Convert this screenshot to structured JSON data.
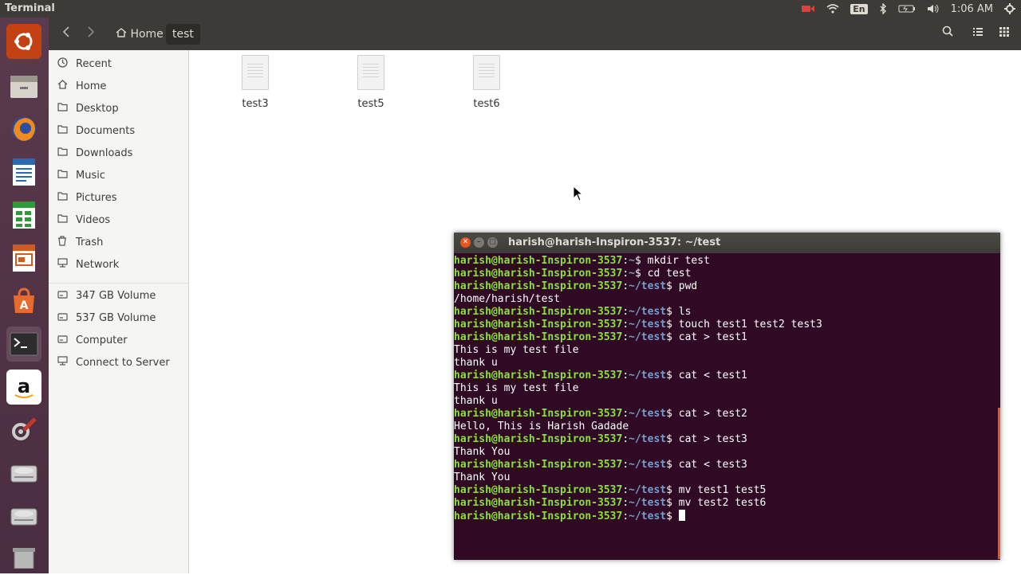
{
  "top_panel": {
    "title": "Terminal",
    "time": "1:06 AM",
    "lang": "En",
    "icons": [
      "camera-icon",
      "wifi-icon",
      "language-icon",
      "bluetooth-icon",
      "battery-icon",
      "volume-icon",
      "gear-icon"
    ]
  },
  "launcher": {
    "items": [
      "ubuntu-icon",
      "files-icon",
      "firefox-icon",
      "writer-icon",
      "calc-icon",
      "impress-icon",
      "software-center-icon",
      "terminal-icon",
      "amazon-icon",
      "settings-icon",
      "disk-icon",
      "disk-icon",
      "trash-icon"
    ]
  },
  "header": {
    "crumbs": [
      "Home",
      "test"
    ],
    "back_icon": "‹",
    "forward_icon": "›"
  },
  "sidebar": {
    "places": [
      "Recent",
      "Home",
      "Desktop",
      "Documents",
      "Downloads",
      "Music",
      "Pictures",
      "Videos",
      "Trash",
      "Network"
    ],
    "devices": [
      "347 GB Volume",
      "537 GB Volume",
      "Computer",
      "Connect to Server"
    ]
  },
  "files": [
    "test3",
    "test5",
    "test6"
  ],
  "terminal": {
    "title": "harish@harish-Inspiron-3537: ~/test",
    "prompt_user": "harish@harish-Inspiron-3537",
    "lines": [
      {
        "type": "cmd",
        "path": "~",
        "text": "mkdir test"
      },
      {
        "type": "cmd",
        "path": "~",
        "text": "cd test"
      },
      {
        "type": "cmd",
        "path": "~/test",
        "text": "pwd"
      },
      {
        "type": "out",
        "text": "/home/harish/test"
      },
      {
        "type": "cmd",
        "path": "~/test",
        "text": "ls"
      },
      {
        "type": "cmd",
        "path": "~/test",
        "text": "touch test1 test2 test3"
      },
      {
        "type": "cmd",
        "path": "~/test",
        "text": "cat > test1"
      },
      {
        "type": "out",
        "text": "This is my test file"
      },
      {
        "type": "out",
        "text": "thank u"
      },
      {
        "type": "cmd",
        "path": "~/test",
        "text": "cat < test1"
      },
      {
        "type": "out",
        "text": "This is my test file"
      },
      {
        "type": "out",
        "text": "thank u"
      },
      {
        "type": "cmd",
        "path": "~/test",
        "text": "cat > test2"
      },
      {
        "type": "out",
        "text": "Hello, This is Harish Gadade"
      },
      {
        "type": "cmd",
        "path": "~/test",
        "text": "cat > test3"
      },
      {
        "type": "out",
        "text": "Thank You"
      },
      {
        "type": "cmd",
        "path": "~/test",
        "text": "cat < test3"
      },
      {
        "type": "out",
        "text": "Thank You"
      },
      {
        "type": "cmd",
        "path": "~/test",
        "text": "mv test1 test5"
      },
      {
        "type": "cmd",
        "path": "~/test",
        "text": "mv test2 test6"
      },
      {
        "type": "cmd",
        "path": "~/test",
        "text": "",
        "cursor": true
      }
    ]
  },
  "colors": {
    "panel": "#3c3b37",
    "terminal_bg": "#300a24",
    "prompt_user": "#8ae234",
    "prompt_path": "#729fcf",
    "accent": "#e95420"
  }
}
